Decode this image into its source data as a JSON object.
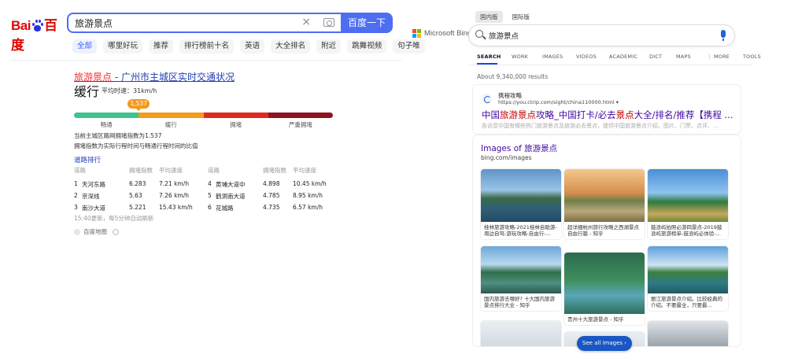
{
  "baidu": {
    "logo_text_left": "Bai",
    "logo_text_right": "百度",
    "search": {
      "query": "旅游景点",
      "clear_icon": "×",
      "button_label": "百度一下"
    },
    "tabs": [
      "全部",
      "哪里好玩",
      "推荐",
      "排行榜前十名",
      "英语",
      "大全排名",
      "附近",
      "跳舞视频",
      "句子唯"
    ],
    "card": {
      "title_em": "旅游景点",
      "title_rest": " - 广州市主城区实时交通状况",
      "status": "缓行",
      "speed_label": "平均时速：31km/h",
      "index_value": "1,537",
      "index_fraction": 0.25,
      "levels": [
        "畅通",
        "缓行",
        "拥堵",
        "严重拥堵"
      ],
      "level_colors": [
        "#3cc48c",
        "#f29b1d",
        "#e0291d",
        "#8e1420"
      ],
      "note_line1": "当前主城区路网拥堵指数为1.537",
      "note_line2": "拥堵指数为实际行程时间与畅通行程时间的比值",
      "ranking_title": "道路排行",
      "headers": [
        "道路",
        "拥堵指数",
        "平均速度",
        "道路",
        "拥堵指数",
        "平均速度"
      ],
      "rows": [
        [
          "1",
          "天河东路",
          "6.283",
          "7.21 km/h",
          "4",
          "黄埔大道中",
          "4.898",
          "10.45 km/h"
        ],
        [
          "2",
          "京深线",
          "5.63",
          "7.26 km/h",
          "5",
          "鹤洞南大道",
          "4.785",
          "8.95 km/h"
        ],
        [
          "3",
          "南沙大道",
          "5.221",
          "15.43 km/h",
          "6",
          "花城路",
          "4.735",
          "6.57 km/h"
        ]
      ],
      "update_note": "15:40更新，每5分钟自动刷新",
      "source": "百度地图"
    }
  },
  "bing": {
    "region_tabs": [
      "国内版",
      "国际版"
    ],
    "logo_text": "Microsoft Bing",
    "logo_colors": [
      "#f25022",
      "#7fba00",
      "#00a4ef",
      "#ffb900"
    ],
    "search": {
      "query": "旅游景点"
    },
    "nav": [
      "SEARCH",
      "WORK",
      "IMAGES",
      "VIDEOS",
      "ACADEMIC",
      "DICT",
      "MAPS",
      "⋮ MORE",
      "TOOLS"
    ],
    "result_count": "About 9,340,000 results",
    "result": {
      "site": "携程攻略",
      "url": "https://you.ctrip.com/sight/china110000.html ▾",
      "title_parts": [
        "中国",
        "旅游景点",
        "攻略_中国打卡/必去",
        "景点",
        "大全/排名/推荐【携程 ..."
      ],
      "snippet": "告诉您中国有哪些热门旅游景点及旅游必去景点，提供中国旅游景点介绍、图片、门票、点评、..."
    },
    "images": {
      "title_plain": "Images of ",
      "title_em": "旅游景点",
      "source": "bing.com/images",
      "tiles": [
        {
          "caption": "桂林旅游攻略-2021桂林自助游-周边自驾-游玩攻略-自由行-..."
        },
        {
          "caption": "超详细杭州旅行攻略之西湖景点自由行篇 - 知乎"
        },
        {
          "caption": "鼓浪屿拍照必游四景点-2019鼓浪屿旅游榜单-鼓浪屿必体验-..."
        },
        {
          "caption": "国内旅游去哪好? 十大国内旅游景点排行大全 - 知乎"
        },
        {
          "caption": "贵州十大旅游景点 - 知乎"
        },
        {
          "caption": "丽江旅游景点介绍。比较经典的介绍。不要最全，只要最..."
        }
      ],
      "see_all": "See all images ›"
    }
  }
}
